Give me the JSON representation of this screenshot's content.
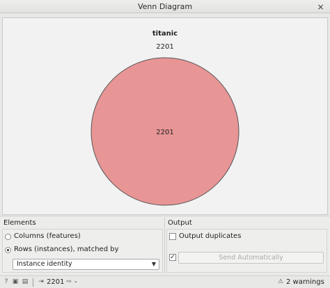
{
  "window": {
    "title": "Venn Diagram",
    "close_glyph": "×"
  },
  "venn": {
    "set_name": "titanic",
    "set_count": "2201",
    "region_count": "2201",
    "fill_color": "#e89595",
    "stroke_color": "#555555"
  },
  "elements": {
    "header": "Elements",
    "option_columns": "Columns (features)",
    "option_rows": "Rows (instances), matched by",
    "selected": "rows",
    "match_by": "Instance identity"
  },
  "output": {
    "header": "Output",
    "duplicates_label": "Output duplicates",
    "duplicates_checked": false,
    "auto_send_checked": true,
    "send_label": "Send Automatically"
  },
  "statusbar": {
    "input_count": "2201",
    "output_value": "-",
    "warnings": "2 warnings"
  }
}
